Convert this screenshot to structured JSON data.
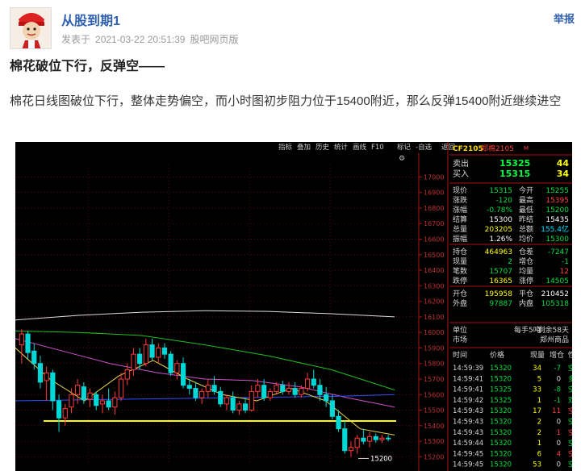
{
  "post": {
    "username": "从股到期1",
    "meta_prefix": "发表于",
    "timestamp": "2021-03-22 20:51:39",
    "source": "股吧网页版",
    "report_label": "举报",
    "title": "棉花破位下行，反弹空——",
    "body": "棉花日线图破位下行，整体走势偏空，而小时图初步阻力位于15400附近，那么反弹15400附近继续进空"
  },
  "terminal": {
    "toolbar": [
      "指标",
      "叠加",
      "历史",
      "统计",
      "画线",
      "F10",
      "标记",
      "-自选",
      "返回"
    ],
    "price_axis": [
      "17000",
      "16900",
      "16800",
      "16700",
      "16600",
      "16500",
      "16400",
      "16300",
      "16200",
      "16100",
      "16000",
      "15900",
      "15800",
      "15700",
      "15600",
      "15500",
      "15400",
      "15300",
      "15200"
    ],
    "low_label": "15200",
    "contract_code": "CF2105",
    "contract_name": "郑棉2105",
    "contract_tag": "M",
    "orderbook": [
      {
        "label": "卖出",
        "price": "15325",
        "volume": "44"
      },
      {
        "label": "买入",
        "price": "15315",
        "volume": "34"
      }
    ],
    "quote_rows": [
      [
        "现价",
        "15315",
        "今开",
        "15255"
      ],
      [
        "涨跌",
        "-120",
        "最高",
        "15395"
      ],
      [
        "涨幅",
        "-0.78%",
        "最低",
        "15200"
      ],
      [
        "结算",
        "15300",
        "昨结",
        "15435"
      ],
      [
        "总量",
        "203205",
        "总额",
        "155.4亿"
      ],
      [
        "振幅",
        "1.26%",
        "均价",
        "15300"
      ],
      [
        "持仓",
        "464963",
        "仓差",
        "-7247"
      ],
      [
        "现量",
        "2",
        "增仓",
        "-1"
      ],
      [
        "笔数",
        "15707",
        "均量",
        "12"
      ],
      [
        "跌停",
        "16365",
        "涨停",
        "14505"
      ],
      [
        "开仓",
        "195958",
        "平仓",
        "210452"
      ],
      [
        "外盘",
        "97887",
        "内盘",
        "105318"
      ]
    ],
    "unit": {
      "label": "单位",
      "value": "每手5吨",
      "extra": "剩余58天"
    },
    "market": {
      "label": "市场",
      "value": "郑州商品"
    },
    "trade_header": [
      "时间",
      "价格",
      "现量",
      "增仓",
      "性质"
    ],
    "trades": [
      [
        "14:59:39",
        "15320",
        "34",
        "-7",
        "空平"
      ],
      [
        "14:59:41",
        "15320",
        "5",
        "0",
        "多换"
      ],
      [
        "14:59:41",
        "15325",
        "33",
        "-8",
        "空平"
      ],
      [
        "14:59:42",
        "15325",
        "1",
        "-1",
        "双平"
      ],
      [
        "14:59:43",
        "15320",
        "17",
        "11",
        "空开"
      ],
      [
        "14:59:43",
        "15320",
        "2",
        "0",
        "空换"
      ],
      [
        "14:59:43",
        "15320",
        "2",
        "1",
        "空开"
      ],
      [
        "14:59:44",
        "15320",
        "1",
        "0",
        "空换"
      ],
      [
        "14:59:45",
        "15320",
        "6",
        "4",
        "空开"
      ],
      [
        "14:59:45",
        "15320",
        "53",
        "0",
        "空换"
      ]
    ],
    "colors": {
      "up": "#ff3b3b",
      "down": "#00d8d8",
      "flat": "#ffffff",
      "level_line": "#ffff00",
      "ma_yellow": "#e8d84a",
      "ma_magenta": "#d050d0",
      "ma_green": "#20c020",
      "ma_white": "#dddddd",
      "ma_blue": "#3050ff"
    }
  },
  "chart_data": {
    "type": "candlestick",
    "title": "",
    "ylim": [
      15150,
      17080
    ],
    "support_level": 15430,
    "low_label_value": 15200,
    "candles": [
      {
        "o": 15920,
        "h": 16020,
        "l": 15800,
        "c": 15990
      },
      {
        "o": 15990,
        "h": 16010,
        "l": 15830,
        "c": 15870
      },
      {
        "o": 15880,
        "h": 15930,
        "l": 15760,
        "c": 15800
      },
      {
        "o": 15800,
        "h": 15850,
        "l": 15640,
        "c": 15680
      },
      {
        "o": 15690,
        "h": 15780,
        "l": 15560,
        "c": 15740
      },
      {
        "o": 15740,
        "h": 15760,
        "l": 15500,
        "c": 15560
      },
      {
        "o": 15560,
        "h": 15600,
        "l": 15360,
        "c": 15450
      },
      {
        "o": 15450,
        "h": 15540,
        "l": 15400,
        "c": 15510
      },
      {
        "o": 15520,
        "h": 15640,
        "l": 15480,
        "c": 15600
      },
      {
        "o": 15600,
        "h": 15700,
        "l": 15540,
        "c": 15660
      },
      {
        "o": 15650,
        "h": 15680,
        "l": 15540,
        "c": 15570
      },
      {
        "o": 15570,
        "h": 15640,
        "l": 15520,
        "c": 15610
      },
      {
        "o": 15600,
        "h": 15620,
        "l": 15500,
        "c": 15530
      },
      {
        "o": 15540,
        "h": 15600,
        "l": 15480,
        "c": 15560
      },
      {
        "o": 15560,
        "h": 15640,
        "l": 15500,
        "c": 15520
      },
      {
        "o": 15520,
        "h": 15620,
        "l": 15470,
        "c": 15580
      },
      {
        "o": 15580,
        "h": 15740,
        "l": 15560,
        "c": 15700
      },
      {
        "o": 15700,
        "h": 15800,
        "l": 15660,
        "c": 15760
      },
      {
        "o": 15760,
        "h": 15900,
        "l": 15720,
        "c": 15860
      },
      {
        "o": 15860,
        "h": 15900,
        "l": 15760,
        "c": 15800
      },
      {
        "o": 15800,
        "h": 15960,
        "l": 15780,
        "c": 15920
      },
      {
        "o": 15920,
        "h": 15960,
        "l": 15820,
        "c": 15840
      },
      {
        "o": 15840,
        "h": 15930,
        "l": 15800,
        "c": 15900
      },
      {
        "o": 15900,
        "h": 15930,
        "l": 15830,
        "c": 15860
      },
      {
        "o": 15860,
        "h": 15880,
        "l": 15720,
        "c": 15740
      },
      {
        "o": 15740,
        "h": 15820,
        "l": 15700,
        "c": 15800
      },
      {
        "o": 15800,
        "h": 15840,
        "l": 15640,
        "c": 15660
      },
      {
        "o": 15660,
        "h": 15700,
        "l": 15600,
        "c": 15640
      },
      {
        "o": 15640,
        "h": 15680,
        "l": 15560,
        "c": 15580
      },
      {
        "o": 15580,
        "h": 15640,
        "l": 15540,
        "c": 15620
      },
      {
        "o": 15620,
        "h": 15700,
        "l": 15580,
        "c": 15660
      },
      {
        "o": 15660,
        "h": 15720,
        "l": 15600,
        "c": 15620
      },
      {
        "o": 15620,
        "h": 15650,
        "l": 15520,
        "c": 15540
      },
      {
        "o": 15540,
        "h": 15600,
        "l": 15500,
        "c": 15580
      },
      {
        "o": 15580,
        "h": 15620,
        "l": 15480,
        "c": 15500
      },
      {
        "o": 15500,
        "h": 15560,
        "l": 15470,
        "c": 15540
      },
      {
        "o": 15540,
        "h": 15580,
        "l": 15480,
        "c": 15500
      },
      {
        "o": 15500,
        "h": 15660,
        "l": 15490,
        "c": 15620
      },
      {
        "o": 15620,
        "h": 15700,
        "l": 15580,
        "c": 15660
      },
      {
        "o": 15660,
        "h": 15700,
        "l": 15560,
        "c": 15580
      },
      {
        "o": 15580,
        "h": 15640,
        "l": 15560,
        "c": 15620
      },
      {
        "o": 15620,
        "h": 15680,
        "l": 15600,
        "c": 15660
      },
      {
        "o": 15660,
        "h": 15690,
        "l": 15600,
        "c": 15620
      },
      {
        "o": 15620,
        "h": 15680,
        "l": 15600,
        "c": 15640
      },
      {
        "o": 15640,
        "h": 15680,
        "l": 15580,
        "c": 15600
      },
      {
        "o": 15600,
        "h": 15660,
        "l": 15580,
        "c": 15640
      },
      {
        "o": 15640,
        "h": 15740,
        "l": 15620,
        "c": 15700
      },
      {
        "o": 15700,
        "h": 15760,
        "l": 15640,
        "c": 15660
      },
      {
        "o": 15660,
        "h": 15700,
        "l": 15560,
        "c": 15600
      },
      {
        "o": 15600,
        "h": 15650,
        "l": 15520,
        "c": 15560
      },
      {
        "o": 15560,
        "h": 15600,
        "l": 15440,
        "c": 15460
      },
      {
        "o": 15460,
        "h": 15500,
        "l": 15360,
        "c": 15380
      },
      {
        "o": 15380,
        "h": 15430,
        "l": 15220,
        "c": 15240
      },
      {
        "o": 15240,
        "h": 15300,
        "l": 15200,
        "c": 15260
      },
      {
        "o": 15260,
        "h": 15340,
        "l": 15220,
        "c": 15320
      },
      {
        "o": 15320,
        "h": 15380,
        "l": 15280,
        "c": 15300
      },
      {
        "o": 15300,
        "h": 15360,
        "l": 15260,
        "c": 15330
      },
      {
        "o": 15330,
        "h": 15350,
        "l": 15290,
        "c": 15310
      },
      {
        "o": 15310,
        "h": 15340,
        "l": 15290,
        "c": 15320
      },
      {
        "o": 15320,
        "h": 15340,
        "l": 15300,
        "c": 15315
      }
    ],
    "moving_averages": [
      {
        "color": "ma_white",
        "points": [
          16080,
          16110,
          16130,
          16140,
          16135,
          16120,
          16100
        ]
      },
      {
        "color": "ma_green",
        "points": [
          16010,
          16000,
          15980,
          15920,
          15850,
          15760,
          15630
        ]
      },
      {
        "color": "ma_magenta",
        "points": [
          15960,
          15880,
          15800,
          15740,
          15700,
          15690,
          15650,
          15580,
          15520
        ]
      },
      {
        "color": "ma_blue",
        "points": [
          15560,
          15565,
          15570,
          15575,
          15580,
          15585,
          15590,
          15600
        ]
      },
      {
        "color": "ma_yellow",
        "points": [
          15900,
          15700,
          15560,
          15720,
          15820,
          15700,
          15600,
          15560,
          15640,
          15560,
          15380,
          15340
        ]
      }
    ]
  }
}
